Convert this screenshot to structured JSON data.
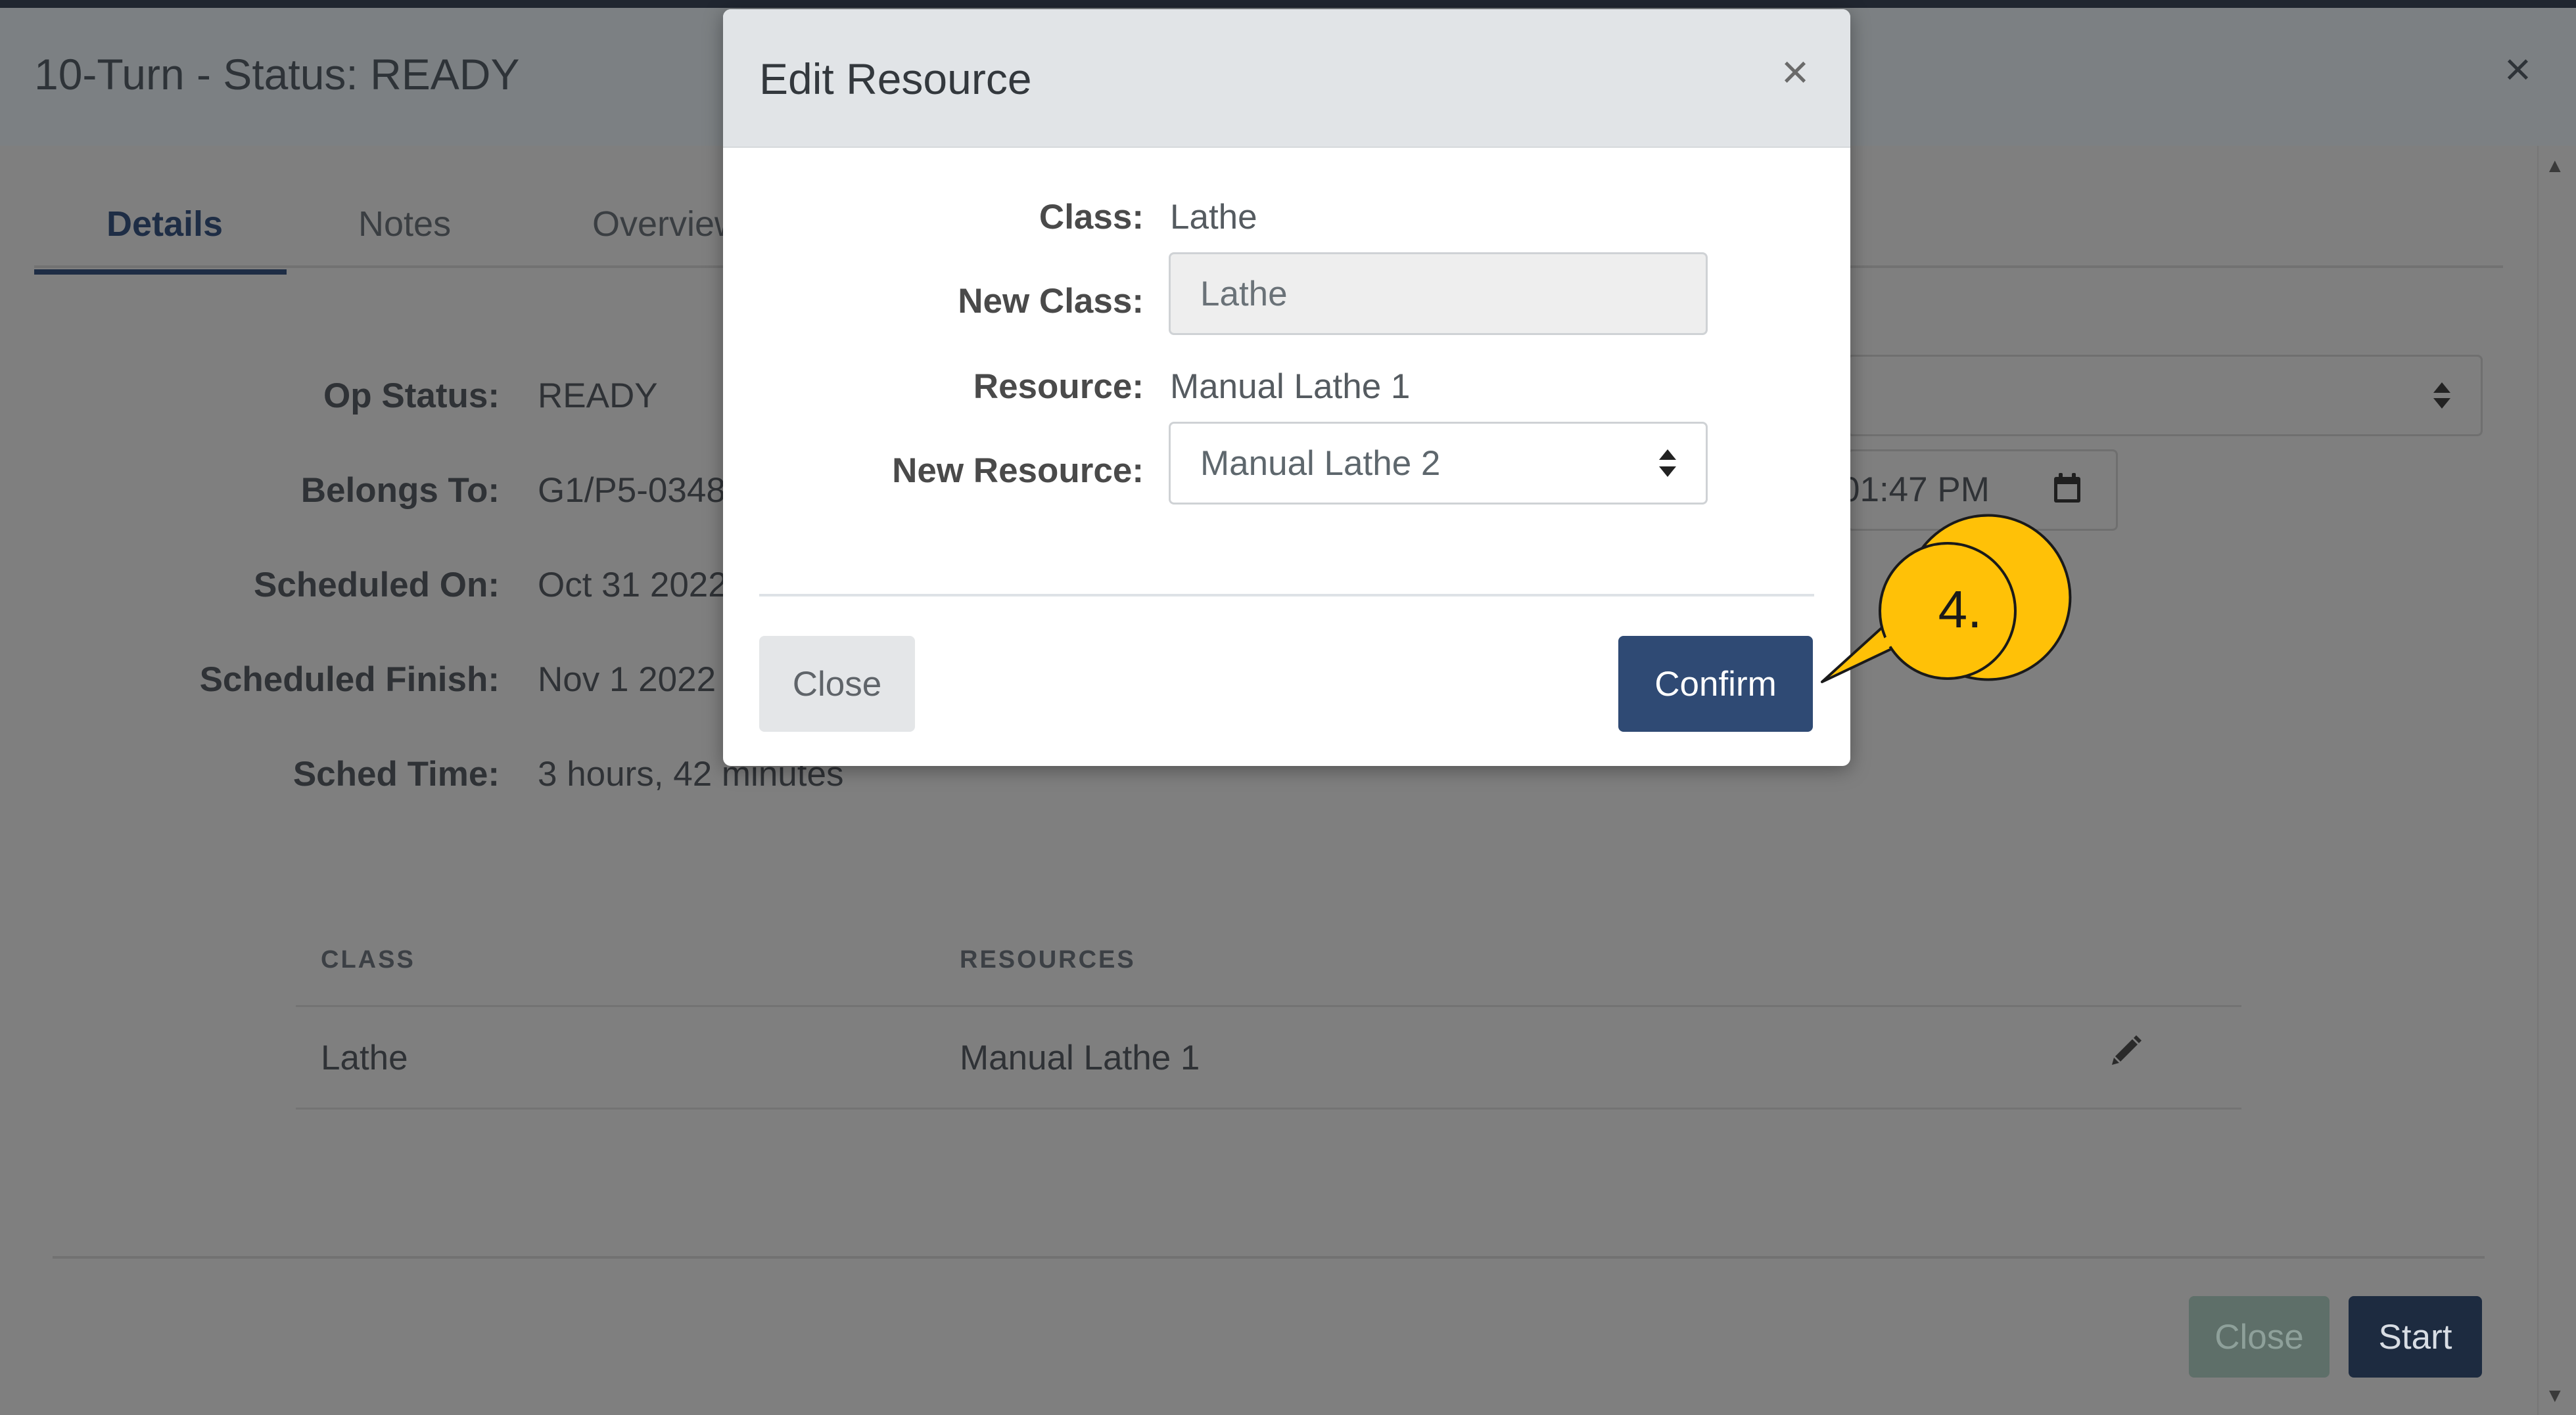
{
  "background_modal": {
    "title": "10-Turn - Status: READY",
    "close_glyph": "×",
    "tabs": [
      {
        "label": "Details",
        "active": true
      },
      {
        "label": "Notes",
        "active": false
      },
      {
        "label": "Overview",
        "active": false
      }
    ],
    "fields": [
      {
        "label": "Op Status:",
        "value": "READY"
      },
      {
        "label": "Belongs To:",
        "value": "G1/P5-0348"
      },
      {
        "label": "Scheduled On:",
        "value": "Oct 31 2022"
      },
      {
        "label": "Scheduled Finish:",
        "value": "Nov 1 2022 "
      },
      {
        "label": "Sched Time:",
        "value": "3 hours, 42 minutes"
      }
    ],
    "date_input_partial": "01:47 PM",
    "table": {
      "headers": [
        "CLASS",
        "RESOURCES"
      ],
      "rows": [
        {
          "class": "Lathe",
          "resources": "Manual Lathe 1"
        }
      ]
    },
    "footer": {
      "close_label": "Close",
      "start_label": "Start"
    }
  },
  "dialog": {
    "title": "Edit Resource",
    "close_glyph": "×",
    "class_label": "Class:",
    "class_value": "Lathe",
    "new_class_label": "New Class:",
    "new_class_value": "Lathe",
    "resource_label": "Resource:",
    "resource_value": "Manual Lathe 1",
    "new_resource_label": "New Resource:",
    "new_resource_value": "Manual Lathe 2",
    "close_label": "Close",
    "confirm_label": "Confirm"
  },
  "callout": {
    "text": "4.",
    "color": "#ffc107"
  },
  "icons": [
    "close-icon",
    "select-arrows-icon",
    "calendar-icon",
    "pencil-icon",
    "scroll-up-icon",
    "scroll-down-icon"
  ],
  "colors": {
    "overlay": "#7f7f7f",
    "primary": "#2f4a74",
    "dialog_header": "#e1e4e7",
    "callout": "#ffc107"
  }
}
